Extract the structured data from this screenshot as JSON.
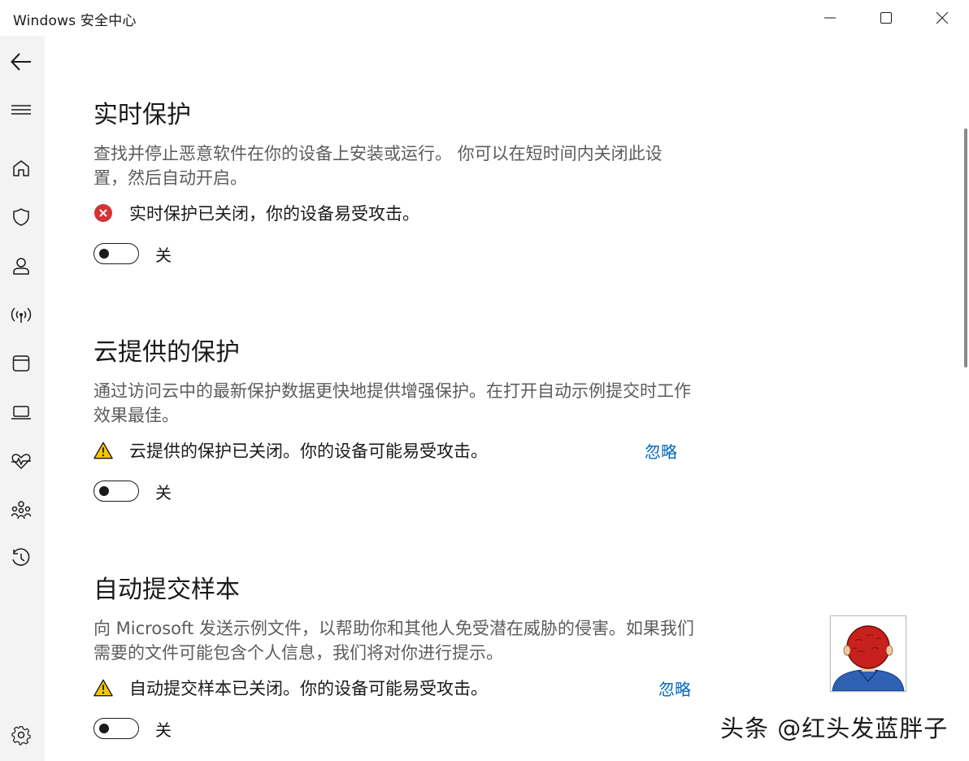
{
  "window": {
    "title": "Windows 安全中心",
    "controls": [
      "minimize-icon",
      "maximize-icon",
      "close-icon"
    ]
  },
  "sidebar": {
    "items": [
      {
        "name": "back",
        "icon": "back-arrow-icon"
      },
      {
        "name": "menu",
        "icon": "hamburger-menu-icon"
      },
      {
        "name": "home",
        "icon": "home-icon"
      },
      {
        "name": "virus-protection",
        "icon": "shield-icon"
      },
      {
        "name": "account-protection",
        "icon": "person-icon"
      },
      {
        "name": "firewall",
        "icon": "wireless-signal-icon"
      },
      {
        "name": "app-browser-control",
        "icon": "browser-window-icon"
      },
      {
        "name": "device-security",
        "icon": "laptop-icon"
      },
      {
        "name": "device-performance",
        "icon": "heart-pulse-icon"
      },
      {
        "name": "family-options",
        "icon": "family-icon"
      },
      {
        "name": "protection-history",
        "icon": "history-icon"
      },
      {
        "name": "settings",
        "icon": "gear-icon"
      }
    ]
  },
  "sections": [
    {
      "title": "实时保护",
      "description": "查找并停止恶意软件在你的设备上安装或运行。 你可以在短时间内关闭此设置，然后自动开启。",
      "status_icon": "error-circle-icon",
      "status_text": "实时保护已关闭，你的设备易受攻击。",
      "toggle_label": "关",
      "toggle_on": false
    },
    {
      "title": "云提供的保护",
      "description": "通过访问云中的最新保护数据更快地提供增强保护。在打开自动示例提交时工作效果最佳。",
      "status_icon": "warning-triangle-icon",
      "status_text": "云提供的保护已关闭。你的设备可能易受攻击。",
      "dismiss_label": "忽略",
      "toggle_label": "关",
      "toggle_on": false
    },
    {
      "title": "自动提交样本",
      "description": "向 Microsoft 发送示例文件，以帮助你和其他人免受潜在威胁的侵害。如果我们需要的文件可能包含个人信息，我们将对你进行提示。",
      "status_icon": "warning-triangle-icon",
      "status_text": "自动提交样本已关闭。你的设备可能易受攻击。",
      "dismiss_label": "忽略",
      "toggle_label": "关",
      "toggle_on": false
    }
  ],
  "watermark": "头条 @红头发蓝胖子",
  "colors": {
    "sidebar_bg": "#f3f3f3",
    "link": "#0067c0",
    "error": "#d13438",
    "warning": "#f7c600",
    "description_text": "#5c5c5c"
  }
}
